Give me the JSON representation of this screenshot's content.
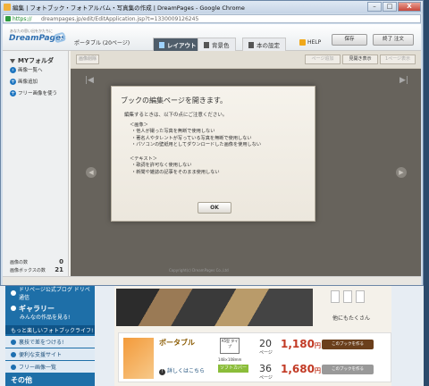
{
  "window": {
    "title": "編集 | フォトブック・フォトアルバム・写真集の作成 | DreamPages - Google Chrome",
    "url_scheme": "https://",
    "url_rest": "dreampages.jp/edit/EditApplication.jsp?t=1330009126245",
    "minimize": "–",
    "maximize": "□",
    "close": "X"
  },
  "app": {
    "logo_sub": "あなたの思い出をかたちに",
    "logo": "DreamPages",
    "book_type": "ポータブル (20ページ)",
    "tabs": [
      {
        "label": "レイアウト"
      },
      {
        "label": "背景色"
      },
      {
        "label": "本の設定"
      }
    ],
    "help": "HELP",
    "save": "保存",
    "finish_order": "終了  注文"
  },
  "sidebar": {
    "title": "MYフォルダ",
    "items": [
      {
        "label": "画像一覧へ"
      },
      {
        "label": "画像追加"
      },
      {
        "label": "フリー画像を使う"
      }
    ],
    "stats": [
      {
        "label": "画像の数",
        "value": "0"
      },
      {
        "label": "画像ボックスの数",
        "value": "21"
      }
    ]
  },
  "toolbar": {
    "left_btn": "画像削除",
    "right_btns": [
      {
        "label": "ページ追加"
      },
      {
        "label": "見開き表示"
      },
      {
        "label": "1ページ表示"
      }
    ]
  },
  "editor": {
    "first": "|◀",
    "last": "▶|",
    "prev": "◀",
    "next": "▶",
    "copyright": "Copyright(c) DreamPages Co.,Ltd"
  },
  "dialog": {
    "title": "ブックの編集ページを開きます。",
    "intro": "編集するときは、以下の点にご注意ください。",
    "image_head": "＜画像＞",
    "image_lines": [
      "・他人が撮った写真を無断で使用しない",
      "・著名人やタレントが写っている写真を無断で使用しない",
      "・パソコンの壁紙用としてダウンロードした画像を使用しない"
    ],
    "text_head": "＜テキスト＞",
    "text_lines": [
      "・歌詞を許可なく使用しない",
      "・新聞や雑誌の記事をそのまま使用しない"
    ],
    "ok": "OK"
  },
  "background": {
    "side_items": [
      {
        "label": "ドリページ公式ブログ ドリペ通信"
      },
      {
        "label": "ギャラリー"
      },
      {
        "label": "みんなの作品を見る!"
      },
      {
        "label": "もっと楽しいフォトブックライフ!"
      },
      {
        "label": "裏技で差をつける!"
      },
      {
        "label": "便利な支援サイト"
      },
      {
        "label": "フリー画像一覧"
      },
      {
        "label": "その他"
      }
    ],
    "more_text": "他にもたくさん",
    "product": {
      "title": "ポータブル",
      "detail_link": "詳しくはこちら",
      "badge": "A5型 タイプ",
      "size": "148×108mm",
      "cover": "ソフトカバー",
      "rows": [
        {
          "pages": "20",
          "pages_unit": "ページ",
          "price": "1,180",
          "yen": "円",
          "cart": "このブックを作る"
        },
        {
          "pages": "36",
          "pages_unit": "ページ",
          "price": "1,680",
          "yen": "円",
          "cart": "このブックを作る"
        }
      ]
    }
  }
}
